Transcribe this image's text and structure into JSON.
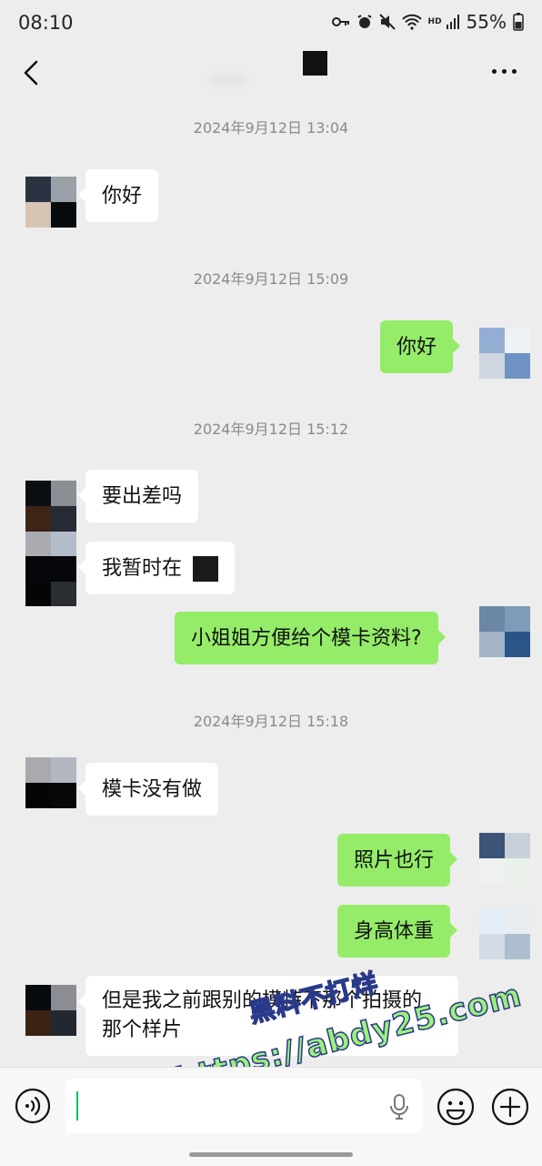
{
  "status": {
    "time": "08:10",
    "hd": "HD",
    "battery": "55%"
  },
  "header": {
    "back_icon": "chevron-left-icon",
    "more_icon": "more-dots-icon"
  },
  "timestamps": [
    "2024年9月12日 13:04",
    "2024年9月12日 15:09",
    "2024年9月12日 15:12",
    "2024年9月12日 15:18"
  ],
  "messages": [
    {
      "side": "in",
      "text": "你好"
    },
    {
      "side": "out",
      "text": "你好"
    },
    {
      "side": "in",
      "text": "要出差吗"
    },
    {
      "side": "in",
      "text": "我暂时在"
    },
    {
      "side": "out",
      "text": "小姐姐方便给个模卡资料?"
    },
    {
      "side": "in",
      "text": "模卡没有做"
    },
    {
      "side": "out",
      "text": "照片也行"
    },
    {
      "side": "out",
      "text": "身高体重"
    },
    {
      "side": "in",
      "text": "但是我之前跟别的模特下那个拍摄的",
      "text2": "那个样片"
    }
  ],
  "watermark": {
    "line1": "黑料不打烊",
    "line2": "https://abdy25.com"
  },
  "input_bar": {
    "value": "",
    "icons": [
      "voice-icon",
      "microphone-icon",
      "emoji-icon",
      "plus-icon"
    ]
  },
  "colors": {
    "background": "#ededed",
    "outgoing_bubble": "#95ec69",
    "incoming_bubble": "#ffffff",
    "caret": "#07c160"
  }
}
